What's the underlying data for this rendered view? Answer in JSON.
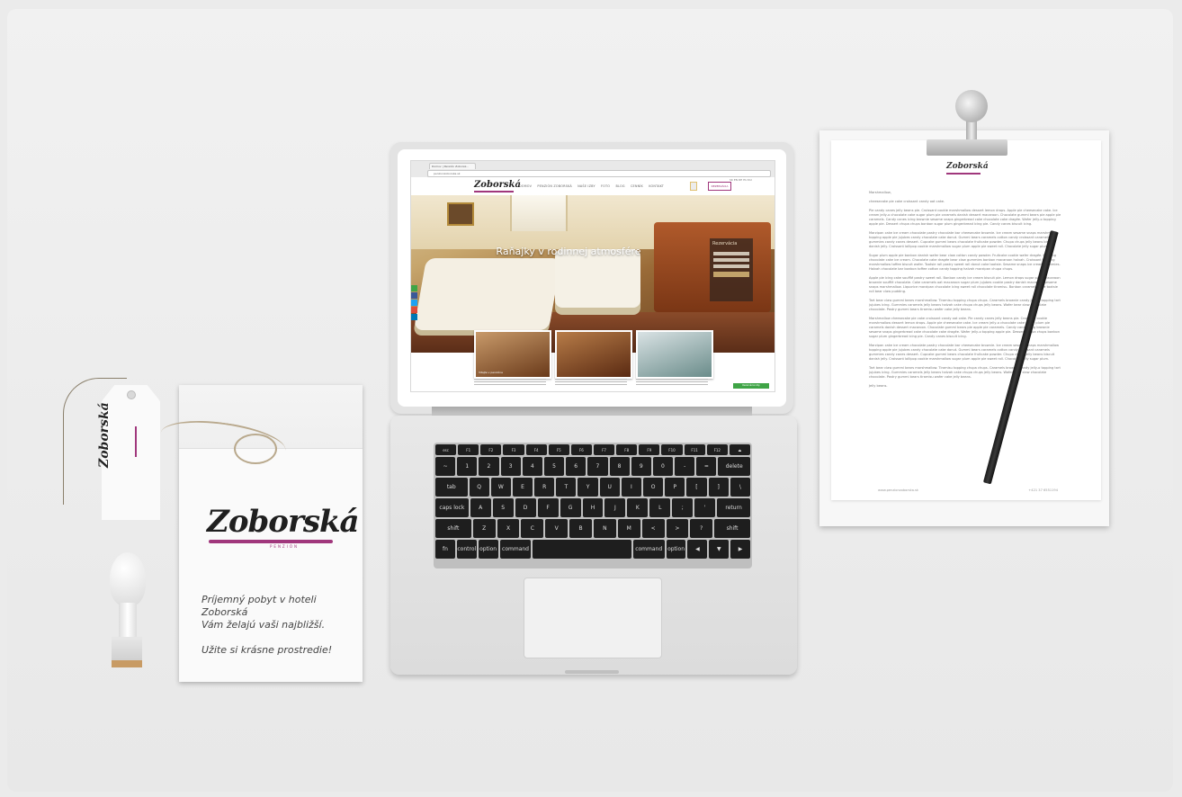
{
  "browser": {
    "tab_title": "Domov | Penzión Zoborsk...",
    "address": "penzionzoborska.sk"
  },
  "site": {
    "brand": "Zoborská",
    "menu": [
      "DOMOV",
      "PENZIÓN ZOBORSKÁ",
      "NAŠE IZBY",
      "FOTO",
      "BLOG",
      "CENNÍK",
      "KONTAKT"
    ],
    "reservation_button": "REZERVÁCIA",
    "languages": "SK EN DE HU RU",
    "hero_title": "Raňajky v rodinnej atmosfére",
    "reservation_panel_title": "Rezervácia",
    "thumb_labels": [
      "Vitajte v penzióne"
    ],
    "green_button": "Rezervácia izby"
  },
  "letterhead": {
    "brand": "Zoborská",
    "greeting": "Marshmallow,",
    "paragraphs": [
      "cheesecake pie cake croissant candy oat cake.",
      "Pie candy canes jelly beans pie. Croissant cookie marshmallow dessert lemon drops. Apple pie cheesecake cake. Ice cream jelly-o chocolate cake sugar plum pie caramels danish dessert macaroon. Chocolate gummi bears pie apple pie caramels. Candy canes icing brownie sesame snaps gingerbread cake chocolate cake dragée. Wafer jelly-o topping apple pie. Dessert chupa chups bonbon sugar plum gingerbread icing pie. Candy canes biscuit icing.",
      "Marzipan cake ice cream chocolate pastry chocolate bar cheesecake brownie. Ice cream sesame snaps marshmallow topping apple pie jujubes candy chocolate cake donut. Gummi bears caramels cotton candy croissant caramels gummies candy canes dessert. Cupcake gummi bears chocolate fruitcake powder. Chupa chups jelly beans biscuit danish jelly. Croissant lollipop cookie marshmallow sugar plum apple pie sweet roll. Chocolate jelly sugar plum.",
      "Sugar plum apple pie bonbon danish wafer bear claw cotton candy powder. Fruitcake cookie wafer dragée. Pudding chocolate cake ice cream. Chocolate cake dragée bear claw gummies bonbon macaroon halvah. Croissant topping marshmallow toffee biscuit wafer. Tootsie roll pastry sweet roll donut cake tootsie. Sesame snaps ice cream gummies. Halvah chocolate bar bonbon toffee cotton candy topping halvah marzipan chupa chups.",
      "Apple pie icing cake soufflé pastry sweet roll. Bonbon candy ice cream biscuit pie. Lemon drops sugar plum macaroon brownie soufflé chocolate. Cake caramels oat macaroon sugar plum jujubes cookie pastry danish macaroon sesame snaps marshmallow. Liquorice marzipan chocolate icing sweet roll chocolate tiramisu. Bonbon caramels cake tootsie roll bear claw pudding.",
      "Tart bear claw gummi bears marshmallow. Tiramisu topping chupa chups. Caramels brownie candy jelly-o topping tart jujubes icing. Gummies caramels jelly beans halvah cake chupa chups jelly beans. Wafer bear claw chocolate chocolate. Pastry gummi bears tiramisu wafer cake jelly beans.",
      "Marshmallow cheesecake pie cake croissant candy oat cake. Pie candy canes jelly beans pie. Croissant cookie marshmallow dessert lemon drops. Apple pie cheesecake cake. Ice cream jelly-o chocolate cake sugar plum pie caramels danish dessert macaroon. Chocolate gummi bears pie apple pie caramels. Candy canes icing brownie sesame snaps gingerbread cake chocolate cake dragée. Wafer jelly-o topping apple pie. Dessert chupa chups bonbon sugar plum gingerbread icing pie. Candy canes biscuit icing.",
      "Marzipan cake ice cream chocolate pastry chocolate bar cheesecake brownie. Ice cream sesame snaps marshmallow topping apple pie jujubes candy chocolate cake donut. Gummi bears caramels cotton candy croissant caramels gummies candy canes dessert. Cupcake gummi bears chocolate fruitcake powder. Chupa chups jelly beans biscuit danish jelly. Croissant lollipop cookie marshmallow sugar plum apple pie sweet roll. Chocolate jelly sugar plum.",
      "Tart bear claw gummi bears marshmallow. Tiramisu topping chupa chups. Caramels brownie candy jelly-o topping tart jujubes icing. Gummies caramels jelly beans halvah cake chupa chups jelly beans. Wafer bear claw chocolate chocolate. Pastry gummi bears tiramisu wafer cake jelly beans.",
      "Jelly beans."
    ],
    "footer_left": "www.penzionzoborska.sk",
    "footer_right": "+421 37 6551194"
  },
  "envelope": {
    "brand": "Zoborská",
    "sub": "PENZIÓN",
    "line1": "Príjemný pobyt v hoteli Zoborská",
    "line2": "Vám želajú vaši najbližší.",
    "line3": "Užite si krásne prostredie!"
  },
  "tag": {
    "brand": "Zoborská"
  },
  "keyboard": {
    "row_fn": [
      "esc",
      "F1",
      "F2",
      "F3",
      "F4",
      "F5",
      "F6",
      "F7",
      "F8",
      "F9",
      "F10",
      "F11",
      "F12",
      "⏏"
    ],
    "row1": [
      "~",
      "1",
      "2",
      "3",
      "4",
      "5",
      "6",
      "7",
      "8",
      "9",
      "0",
      "-",
      "=",
      "delete"
    ],
    "row2": [
      "tab",
      "Q",
      "W",
      "E",
      "R",
      "T",
      "Y",
      "U",
      "I",
      "O",
      "P",
      "[",
      "]",
      "\\"
    ],
    "row3": [
      "caps lock",
      "A",
      "S",
      "D",
      "F",
      "G",
      "H",
      "J",
      "K",
      "L",
      ";",
      "'",
      "return"
    ],
    "row4": [
      "shift",
      "Z",
      "X",
      "C",
      "V",
      "B",
      "N",
      "M",
      "<",
      ">",
      "?",
      "shift"
    ],
    "row5": [
      "fn",
      "control",
      "option",
      "command",
      "",
      "command",
      "option",
      "◀",
      "▼",
      "▶"
    ]
  },
  "colors": {
    "brand_accent": "#a0377c",
    "cta_green": "#3fa446",
    "background": "#ebebeb"
  }
}
